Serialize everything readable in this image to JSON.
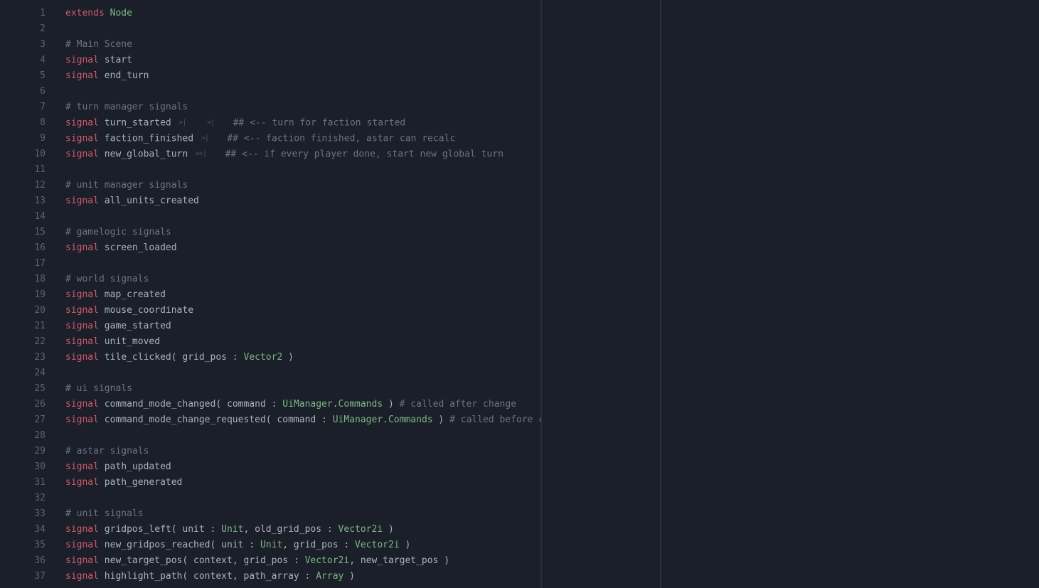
{
  "lines": [
    {
      "n": 1,
      "tokens": [
        {
          "t": "extends",
          "c": "tk-kw"
        },
        {
          "t": " ",
          "c": ""
        },
        {
          "t": "Node",
          "c": "tk-type"
        }
      ]
    },
    {
      "n": 2,
      "tokens": []
    },
    {
      "n": 3,
      "tokens": [
        {
          "t": "# Main Scene",
          "c": "tk-comment"
        }
      ]
    },
    {
      "n": 4,
      "tokens": [
        {
          "t": "signal",
          "c": "tk-kw"
        },
        {
          "t": " ",
          "c": ""
        },
        {
          "t": "start",
          "c": "tk-ident"
        }
      ]
    },
    {
      "n": 5,
      "tokens": [
        {
          "t": "signal",
          "c": "tk-kw"
        },
        {
          "t": " ",
          "c": ""
        },
        {
          "t": "end_turn",
          "c": "tk-ident"
        }
      ]
    },
    {
      "n": 6,
      "tokens": []
    },
    {
      "n": 7,
      "tokens": [
        {
          "t": "# turn manager signals",
          "c": "tk-comment"
        }
      ]
    },
    {
      "n": 8,
      "tokens": [
        {
          "t": "signal",
          "c": "tk-kw"
        },
        {
          "t": " ",
          "c": ""
        },
        {
          "t": "turn_started",
          "c": "tk-ident"
        },
        {
          "t": " ",
          "c": ""
        },
        {
          "t": ">|",
          "c": "tk-badge"
        },
        {
          "t": "   ",
          "c": ""
        },
        {
          "t": ">|",
          "c": "tk-badge"
        },
        {
          "t": "   ",
          "c": ""
        },
        {
          "t": "## <-- turn for faction started",
          "c": "tk-comment"
        }
      ]
    },
    {
      "n": 9,
      "tokens": [
        {
          "t": "signal",
          "c": "tk-kw"
        },
        {
          "t": " ",
          "c": ""
        },
        {
          "t": "faction_finished",
          "c": "tk-ident"
        },
        {
          "t": " ",
          "c": ""
        },
        {
          "t": ">|",
          "c": "tk-badge"
        },
        {
          "t": "   ",
          "c": ""
        },
        {
          "t": "## <-- faction finished, astar can recalc",
          "c": "tk-comment"
        }
      ]
    },
    {
      "n": 10,
      "tokens": [
        {
          "t": "signal",
          "c": "tk-kw"
        },
        {
          "t": " ",
          "c": ""
        },
        {
          "t": "new_global_turn",
          "c": "tk-ident"
        },
        {
          "t": " ",
          "c": ""
        },
        {
          "t": ">>|",
          "c": "tk-badge"
        },
        {
          "t": "   ",
          "c": ""
        },
        {
          "t": "## <-- if every player done, start new global turn",
          "c": "tk-comment"
        }
      ]
    },
    {
      "n": 11,
      "tokens": []
    },
    {
      "n": 12,
      "tokens": [
        {
          "t": "# unit manager signals",
          "c": "tk-comment"
        }
      ]
    },
    {
      "n": 13,
      "tokens": [
        {
          "t": "signal",
          "c": "tk-kw"
        },
        {
          "t": " ",
          "c": ""
        },
        {
          "t": "all_units_created",
          "c": "tk-ident"
        }
      ]
    },
    {
      "n": 14,
      "tokens": []
    },
    {
      "n": 15,
      "tokens": [
        {
          "t": "# gamelogic signals",
          "c": "tk-comment"
        }
      ]
    },
    {
      "n": 16,
      "tokens": [
        {
          "t": "signal",
          "c": "tk-kw"
        },
        {
          "t": " ",
          "c": ""
        },
        {
          "t": "screen_loaded",
          "c": "tk-ident"
        }
      ]
    },
    {
      "n": 17,
      "tokens": []
    },
    {
      "n": 18,
      "tokens": [
        {
          "t": "# world signals",
          "c": "tk-comment"
        }
      ]
    },
    {
      "n": 19,
      "tokens": [
        {
          "t": "signal",
          "c": "tk-kw"
        },
        {
          "t": " ",
          "c": ""
        },
        {
          "t": "map_created",
          "c": "tk-ident"
        }
      ]
    },
    {
      "n": 20,
      "tokens": [
        {
          "t": "signal",
          "c": "tk-kw"
        },
        {
          "t": " ",
          "c": ""
        },
        {
          "t": "mouse_coordinate",
          "c": "tk-ident"
        }
      ]
    },
    {
      "n": 21,
      "tokens": [
        {
          "t": "signal",
          "c": "tk-kw"
        },
        {
          "t": " ",
          "c": ""
        },
        {
          "t": "game_started",
          "c": "tk-ident"
        }
      ]
    },
    {
      "n": 22,
      "tokens": [
        {
          "t": "signal",
          "c": "tk-kw"
        },
        {
          "t": " ",
          "c": ""
        },
        {
          "t": "unit_moved",
          "c": "tk-ident"
        }
      ]
    },
    {
      "n": 23,
      "tokens": [
        {
          "t": "signal",
          "c": "tk-kw"
        },
        {
          "t": " ",
          "c": ""
        },
        {
          "t": "tile_clicked",
          "c": "tk-ident"
        },
        {
          "t": "( grid_pos : ",
          "c": "tk-ident"
        },
        {
          "t": "Vector2",
          "c": "tk-type"
        },
        {
          "t": " )",
          "c": "tk-ident"
        }
      ]
    },
    {
      "n": 24,
      "tokens": []
    },
    {
      "n": 25,
      "tokens": [
        {
          "t": "# ui signals",
          "c": "tk-comment"
        }
      ]
    },
    {
      "n": 26,
      "tokens": [
        {
          "t": "signal",
          "c": "tk-kw"
        },
        {
          "t": " ",
          "c": ""
        },
        {
          "t": "command_mode_changed",
          "c": "tk-ident"
        },
        {
          "t": "( command : ",
          "c": "tk-ident"
        },
        {
          "t": "UiManager",
          "c": "tk-type"
        },
        {
          "t": ".",
          "c": "tk-ident"
        },
        {
          "t": "Commands",
          "c": "tk-type"
        },
        {
          "t": " ) ",
          "c": "tk-ident"
        },
        {
          "t": "# called after change",
          "c": "tk-comment"
        }
      ]
    },
    {
      "n": 27,
      "tokens": [
        {
          "t": "signal",
          "c": "tk-kw"
        },
        {
          "t": " ",
          "c": ""
        },
        {
          "t": "command_mode_change_requested",
          "c": "tk-ident"
        },
        {
          "t": "( command : ",
          "c": "tk-ident"
        },
        {
          "t": "UiManager",
          "c": "tk-type"
        },
        {
          "t": ".",
          "c": "tk-ident"
        },
        {
          "t": "Commands",
          "c": "tk-type"
        },
        {
          "t": " ) ",
          "c": "tk-ident"
        },
        {
          "t": "# called before change",
          "c": "tk-comment"
        }
      ]
    },
    {
      "n": 28,
      "tokens": []
    },
    {
      "n": 29,
      "tokens": [
        {
          "t": "# astar signals",
          "c": "tk-comment"
        }
      ]
    },
    {
      "n": 30,
      "tokens": [
        {
          "t": "signal",
          "c": "tk-kw"
        },
        {
          "t": " ",
          "c": ""
        },
        {
          "t": "path_updated",
          "c": "tk-ident"
        }
      ]
    },
    {
      "n": 31,
      "tokens": [
        {
          "t": "signal",
          "c": "tk-kw"
        },
        {
          "t": " ",
          "c": ""
        },
        {
          "t": "path_generated",
          "c": "tk-ident"
        }
      ]
    },
    {
      "n": 32,
      "tokens": []
    },
    {
      "n": 33,
      "tokens": [
        {
          "t": "# unit signals",
          "c": "tk-comment"
        }
      ]
    },
    {
      "n": 34,
      "tokens": [
        {
          "t": "signal",
          "c": "tk-kw"
        },
        {
          "t": " ",
          "c": ""
        },
        {
          "t": "gridpos_left",
          "c": "tk-ident"
        },
        {
          "t": "( unit : ",
          "c": "tk-ident"
        },
        {
          "t": "Unit",
          "c": "tk-type"
        },
        {
          "t": ", old_grid_pos : ",
          "c": "tk-ident"
        },
        {
          "t": "Vector2i",
          "c": "tk-type"
        },
        {
          "t": " )",
          "c": "tk-ident"
        }
      ]
    },
    {
      "n": 35,
      "tokens": [
        {
          "t": "signal",
          "c": "tk-kw"
        },
        {
          "t": " ",
          "c": ""
        },
        {
          "t": "new_gridpos_reached",
          "c": "tk-ident"
        },
        {
          "t": "( unit : ",
          "c": "tk-ident"
        },
        {
          "t": "Unit",
          "c": "tk-type"
        },
        {
          "t": ", grid_pos : ",
          "c": "tk-ident"
        },
        {
          "t": "Vector2i",
          "c": "tk-type"
        },
        {
          "t": " )",
          "c": "tk-ident"
        }
      ]
    },
    {
      "n": 36,
      "tokens": [
        {
          "t": "signal",
          "c": "tk-kw"
        },
        {
          "t": " ",
          "c": ""
        },
        {
          "t": "new_target_pos",
          "c": "tk-ident"
        },
        {
          "t": "( context, grid_pos : ",
          "c": "tk-ident"
        },
        {
          "t": "Vector2i",
          "c": "tk-type"
        },
        {
          "t": ", new_target_pos )",
          "c": "tk-ident"
        }
      ]
    },
    {
      "n": 37,
      "tokens": [
        {
          "t": "signal",
          "c": "tk-kw"
        },
        {
          "t": " ",
          "c": ""
        },
        {
          "t": "highlight_path",
          "c": "tk-ident"
        },
        {
          "t": "( context, path_array : ",
          "c": "tk-ident"
        },
        {
          "t": "Array",
          "c": "tk-type"
        },
        {
          "t": " )",
          "c": "tk-ident"
        }
      ]
    }
  ]
}
